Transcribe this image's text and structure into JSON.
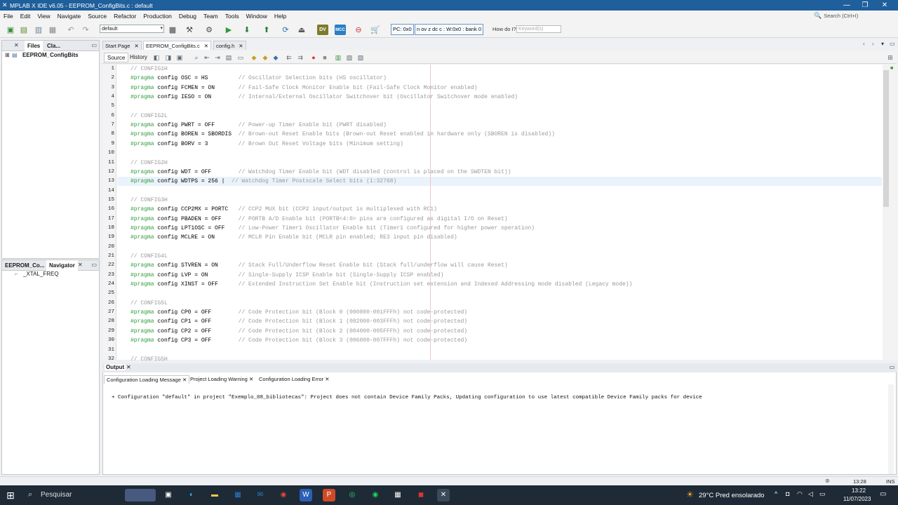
{
  "window": {
    "title": "MPLAB X IDE v6.05 - EEPROM_ConfigBits.c : default"
  },
  "menu": [
    "File",
    "Edit",
    "View",
    "Navigate",
    "Source",
    "Refactor",
    "Production",
    "Debug",
    "Team",
    "Tools",
    "Window",
    "Help"
  ],
  "search": {
    "placeholder": "Search (Ctrl+I)"
  },
  "toolbar": {
    "config": "default",
    "pc": "PC: 0x0",
    "status": "n ov z dc c : W:0x0 : bank 0",
    "howdoi": "How do I?",
    "keyword_placeholder": "Keyword(s)"
  },
  "left_top": {
    "tabs": [
      "Files",
      "Cla..."
    ],
    "project": "EEPROM_ConfigBits"
  },
  "left_bottom": {
    "tabs": [
      "EEPROM_Co...",
      "Navigator"
    ],
    "item": "_XTAL_FREQ"
  },
  "editor_tabs": [
    "Start Page",
    "EEPROM_ConfigBits.c",
    "config.h"
  ],
  "source_tabs": [
    "Source",
    "History"
  ],
  "code": [
    {
      "n": "1",
      "t": "// CONFIG1H",
      "c": 1
    },
    {
      "n": "2",
      "k": "#pragma",
      "t": " config OSC = HS         ",
      "m": "// Oscillator Selection bits (HS oscillator)"
    },
    {
      "n": "3",
      "k": "#pragma",
      "t": " config FCMEN = ON       ",
      "m": "// Fail-Safe Clock Monitor Enable bit (Fail-Safe Clock Monitor enabled)"
    },
    {
      "n": "4",
      "k": "#pragma",
      "t": " config IESO = ON        ",
      "m": "// Internal/External Oscillator Switchover bit (Oscillator Switchover mode enabled)"
    },
    {
      "n": "5",
      "t": ""
    },
    {
      "n": "6",
      "t": "// CONFIG2L",
      "c": 1
    },
    {
      "n": "7",
      "k": "#pragma",
      "t": " config PWRT = OFF       ",
      "m": "// Power-up Timer Enable bit (PWRT disabled)"
    },
    {
      "n": "8",
      "k": "#pragma",
      "t": " config BOREN = SBORDIS  ",
      "m": "// Brown-out Reset Enable bits (Brown-out Reset enabled in hardware only (SBOREN is disabled))"
    },
    {
      "n": "9",
      "k": "#pragma",
      "t": " config BORV = 3         ",
      "m": "// Brown Out Reset Voltage bits (Minimum setting)"
    },
    {
      "n": "10",
      "t": ""
    },
    {
      "n": "11",
      "t": "// CONFIG2H",
      "c": 1
    },
    {
      "n": "12",
      "k": "#pragma",
      "t": " config WDT = OFF        ",
      "m": "// Watchdog Timer Enable bit (WDT disabled (control is placed on the SWDTEN bit))"
    },
    {
      "n": "13",
      "k": "#pragma",
      "t": " config WDTPS = 256 |  ",
      "m": "// Watchdog Timer Postscale Select bits (1:32768)"
    },
    {
      "n": "14",
      "t": ""
    },
    {
      "n": "15",
      "t": "// CONFIG3H",
      "c": 1
    },
    {
      "n": "16",
      "k": "#pragma",
      "t": " config CCP2MX = PORTC   ",
      "m": "// CCP2 MUX bit (CCP2 input/output is multiplexed with RC1)"
    },
    {
      "n": "17",
      "k": "#pragma",
      "t": " config PBADEN = OFF     ",
      "m": "// PORTB A/D Enable bit (PORTB<4:0> pins are configured as digital I/O on Reset)"
    },
    {
      "n": "18",
      "k": "#pragma",
      "t": " config LPT1OSC = OFF    ",
      "m": "// Low-Power Timer1 Oscillator Enable bit (Timer1 configured for higher power operation)"
    },
    {
      "n": "19",
      "k": "#pragma",
      "t": " config MCLRE = ON       ",
      "m": "// MCLR Pin Enable bit (MCLR pin enabled; RE3 input pin disabled)"
    },
    {
      "n": "20",
      "t": ""
    },
    {
      "n": "21",
      "t": "// CONFIG4L",
      "c": 1
    },
    {
      "n": "22",
      "k": "#pragma",
      "t": " config STVREN = ON      ",
      "m": "// Stack Full/Underflow Reset Enable bit (Stack full/underflow will cause Reset)"
    },
    {
      "n": "23",
      "k": "#pragma",
      "t": " config LVP = ON         ",
      "m": "// Single-Supply ICSP Enable bit (Single-Supply ICSP enabled)"
    },
    {
      "n": "24",
      "k": "#pragma",
      "t": " config XINST = OFF      ",
      "m": "// Extended Instruction Set Enable bit (Instruction set extension and Indexed Addressing mode disabled (Legacy mode))"
    },
    {
      "n": "25",
      "t": ""
    },
    {
      "n": "26",
      "t": "// CONFIG5L",
      "c": 1
    },
    {
      "n": "27",
      "k": "#pragma",
      "t": " config CP0 = OFF        ",
      "m": "// Code Protection bit (Block 0 (000800-001FFFh) not code-protected)"
    },
    {
      "n": "28",
      "k": "#pragma",
      "t": " config CP1 = OFF        ",
      "m": "// Code Protection bit (Block 1 (002000-003FFFh) not code-protected)"
    },
    {
      "n": "29",
      "k": "#pragma",
      "t": " config CP2 = OFF        ",
      "m": "// Code Protection bit (Block 2 (004000-005FFFh) not code-protected)"
    },
    {
      "n": "30",
      "k": "#pragma",
      "t": " config CP3 = OFF        ",
      "m": "// Code Protection bit (Block 3 (006000-007FFFh) not code-protected)"
    },
    {
      "n": "31",
      "t": ""
    },
    {
      "n": "32",
      "t": "// CONFIG5H",
      "c": 1
    }
  ],
  "output": {
    "title": "Output",
    "tabs": [
      "Configuration Loading Message",
      "Project Loading Warning",
      "Configuration Loading Error"
    ],
    "message": "+ Configuration \"default\" in project \"Exemplo_08_bibliotecas\": Project does not contain Device Family Packs, Updating configuration to use latest compatible Device Family packs for device"
  },
  "status": {
    "pos": "13:28",
    "mode": "INS"
  },
  "taskbar": {
    "search": "Pesquisar",
    "weather": "29°C  Pred ensolarado",
    "time": "13:22",
    "date": "11/07/2023"
  }
}
